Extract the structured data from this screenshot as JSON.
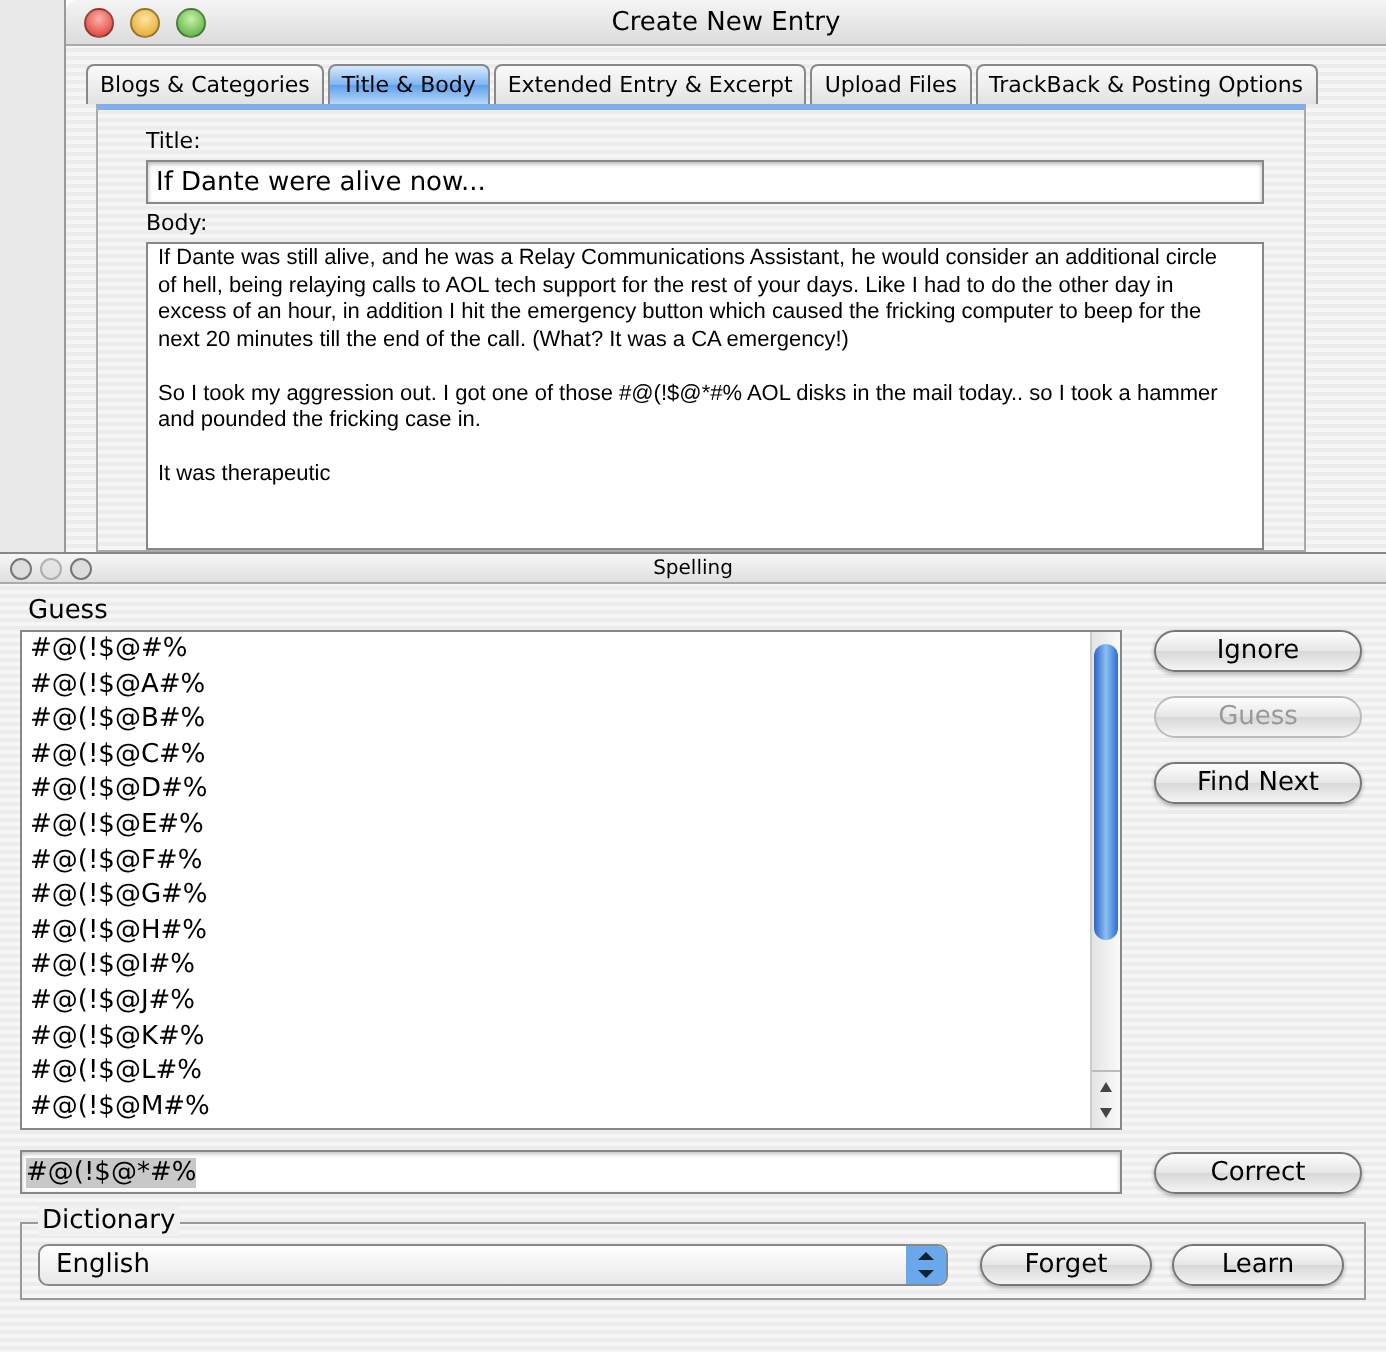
{
  "window": {
    "title": "Create New Entry"
  },
  "tabs": [
    {
      "label": "Blogs & Categories",
      "selected": false
    },
    {
      "label": "Title & Body",
      "selected": true
    },
    {
      "label": "Extended Entry & Excerpt",
      "selected": false
    },
    {
      "label": "Upload Files",
      "selected": false
    },
    {
      "label": "TrackBack & Posting Options",
      "selected": false
    }
  ],
  "title_field": {
    "label": "Title:",
    "value": "If Dante were alive now..."
  },
  "body_field": {
    "label": "Body:",
    "paragraphs": [
      "If Dante was still alive, and he was a Relay Communications Assistant, he would consider an additional circle of hell, being relaying calls to AOL tech support for the rest of your days.  Like I had to do the other day in excess of an hour, in addition I hit the emergency button which caused the fricking computer to beep for the next 20 minutes till the end of the call.  (What? It was a CA emergency!)",
      "So I took my aggression out. I got one of those #@(!$@*#% AOL disks in the mail today..  so I took a hammer and pounded the fricking case in.",
      "It was therapeutic"
    ]
  },
  "spelling_panel": {
    "title": "Spelling",
    "guess_label": "Guess",
    "guesses": [
      {
        "text": "#@(!$@#%",
        "selected": false
      },
      {
        "text": "#@(!$@A#%",
        "selected": false
      },
      {
        "text": "#@(!$@B#%",
        "selected": false
      },
      {
        "text": "#@(!$@C#%",
        "selected": false
      },
      {
        "text": "#@(!$@D#%",
        "selected": false
      },
      {
        "text": "#@(!$@E#%",
        "selected": false
      },
      {
        "text": "#@(!$@F#%",
        "selected": false
      },
      {
        "text": "#@(!$@G#%",
        "selected": false
      },
      {
        "text": "#@(!$@H#%",
        "selected": false
      },
      {
        "text": "#@(!$@I#%",
        "selected": false
      },
      {
        "text": "#@(!$@J#%",
        "selected": false
      },
      {
        "text": "#@(!$@K#%",
        "selected": false
      },
      {
        "text": "#@(!$@L#%",
        "selected": false
      },
      {
        "text": "#@(!$@M#%",
        "selected": false
      }
    ],
    "side_buttons": [
      {
        "label": "Ignore",
        "disabled": false
      },
      {
        "label": "Guess",
        "disabled": true
      },
      {
        "label": "Find Next",
        "disabled": false
      }
    ],
    "word_field": {
      "value": "#@(!$@*#%"
    },
    "correct_button": {
      "label": "Correct",
      "disabled": false
    },
    "dictionary": {
      "label": "Dictionary",
      "value": "English",
      "buttons": [
        {
          "label": "Forget",
          "disabled": false
        },
        {
          "label": "Learn",
          "disabled": false
        }
      ]
    }
  }
}
